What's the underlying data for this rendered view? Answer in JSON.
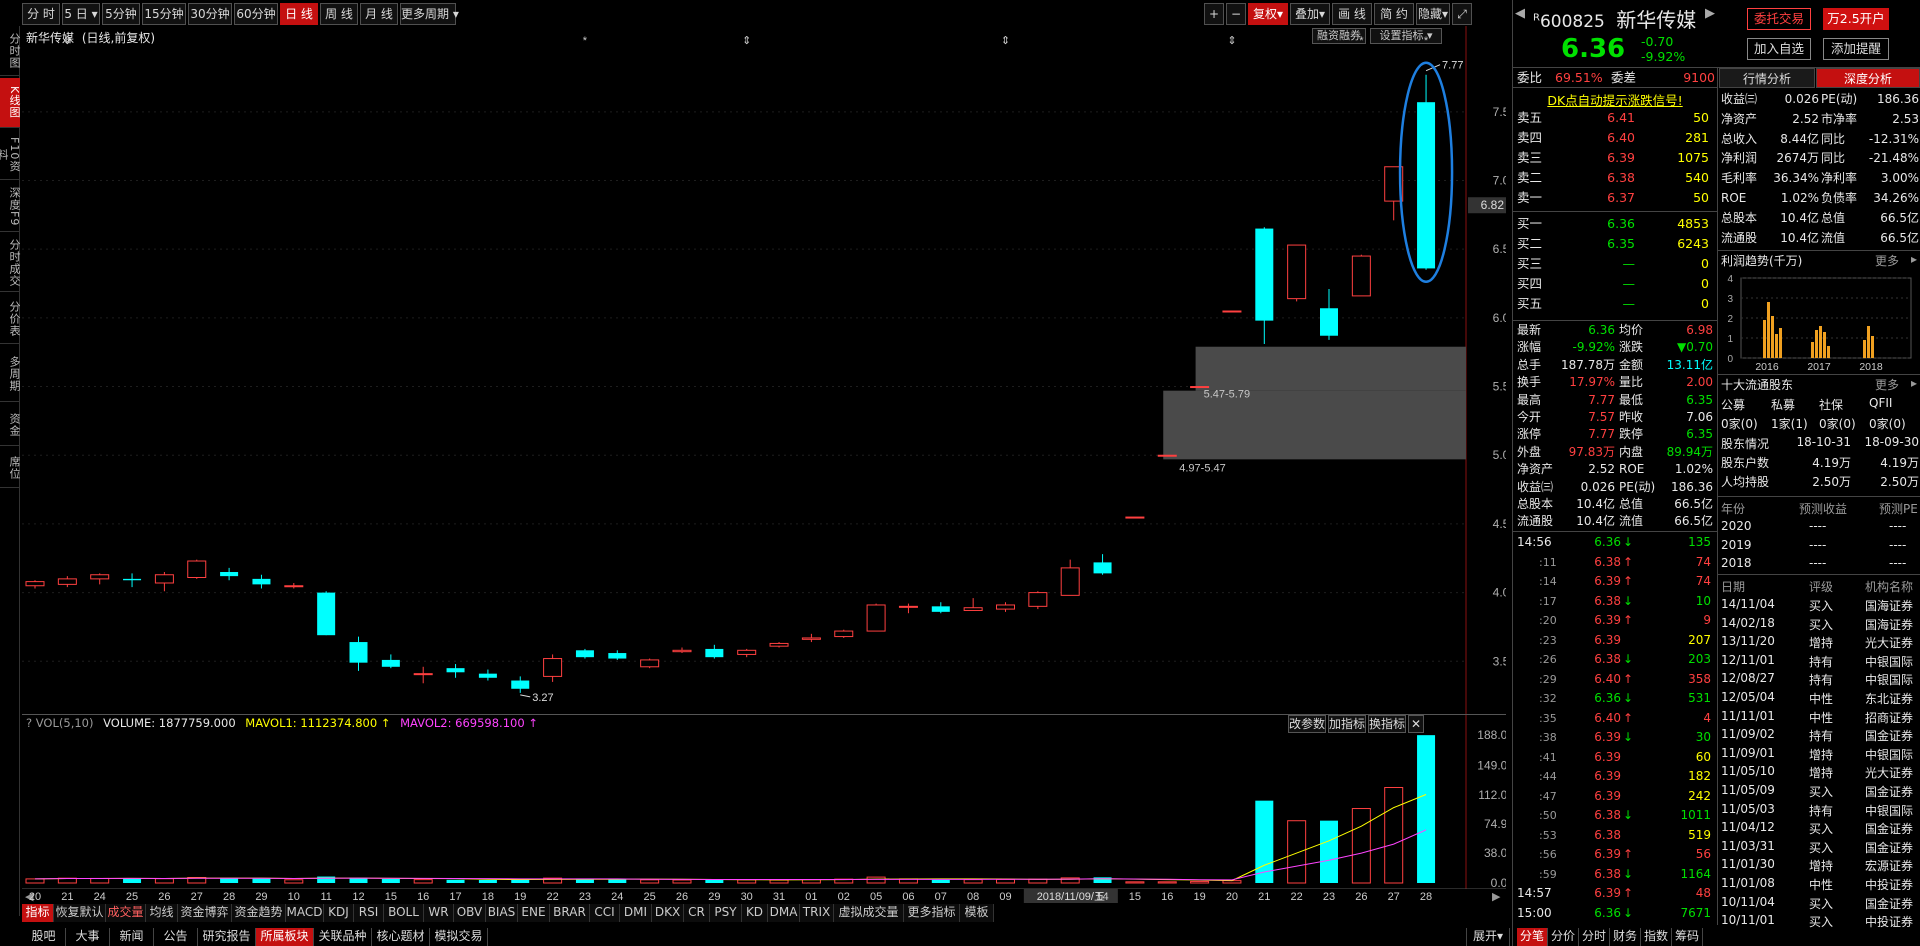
{
  "toolbar": {
    "periods": [
      "分 时",
      "5 日",
      "5分钟",
      "15分钟",
      "30分钟",
      "60分钟",
      "日 线",
      "周 线",
      "月 线",
      "更多周期"
    ],
    "active_period": "日 线",
    "right_buttons": [
      "+",
      "−",
      "复权",
      "叠加",
      "画 线",
      "简 约",
      "隐藏",
      "⤢"
    ]
  },
  "left_tabs": [
    "分时图",
    "K线图",
    "F10资料",
    "深度F9",
    "分时成交",
    "分价表",
    "多周期",
    "资金",
    "席位"
  ],
  "chart": {
    "title": "新华传媒",
    "subtitle": "(日线,前复权)",
    "btn_margin": "融资融券",
    "btn_settings": "设置指标",
    "price_labels": [
      "7.50",
      "7.00",
      "6.50",
      "6.00",
      "5.50",
      "5.00",
      "4.50",
      "4.00",
      "3.50"
    ],
    "current_price_tag": "6.82",
    "high_annot": "7.77",
    "low_annot": "3.27",
    "zone1_label": "5.47-5.79",
    "zone2_label": "4.97-5.47"
  },
  "chart_data": {
    "type": "candlestick",
    "dates": [
      "20",
      "21",
      "24",
      "25",
      "26",
      "27",
      "28",
      "29",
      "10",
      "11",
      "12",
      "15",
      "16",
      "17",
      "18",
      "19",
      "22",
      "23",
      "24",
      "25",
      "26",
      "29",
      "30",
      "31",
      "01",
      "02",
      "05",
      "06",
      "07",
      "08",
      "09",
      "12",
      "13",
      "14",
      "15",
      "16",
      "19",
      "20",
      "21",
      "22",
      "23",
      "26",
      "27",
      "28"
    ],
    "ohlc": [
      [
        4.05,
        4.09,
        4.03,
        4.08
      ],
      [
        4.06,
        4.12,
        4.04,
        4.1
      ],
      [
        4.1,
        4.14,
        4.06,
        4.13
      ],
      [
        4.1,
        4.14,
        4.04,
        4.09
      ],
      [
        4.07,
        4.15,
        4.01,
        4.13
      ],
      [
        4.11,
        4.24,
        4.1,
        4.23
      ],
      [
        4.15,
        4.18,
        4.09,
        4.12
      ],
      [
        4.1,
        4.13,
        4.03,
        4.06
      ],
      [
        4.05,
        4.07,
        4.03,
        4.05
      ],
      [
        4.0,
        4.01,
        3.69,
        3.69
      ],
      [
        3.64,
        3.68,
        3.43,
        3.49
      ],
      [
        3.51,
        3.55,
        3.45,
        3.46
      ],
      [
        3.41,
        3.46,
        3.34,
        3.41
      ],
      [
        3.45,
        3.48,
        3.38,
        3.42
      ],
      [
        3.41,
        3.44,
        3.36,
        3.38
      ],
      [
        3.36,
        3.39,
        3.27,
        3.3
      ],
      [
        3.39,
        3.55,
        3.35,
        3.52
      ],
      [
        3.58,
        3.59,
        3.52,
        3.53
      ],
      [
        3.56,
        3.58,
        3.51,
        3.52
      ],
      [
        3.46,
        3.52,
        3.45,
        3.51
      ],
      [
        3.57,
        3.6,
        3.56,
        3.58
      ],
      [
        3.59,
        3.62,
        3.52,
        3.53
      ],
      [
        3.55,
        3.59,
        3.53,
        3.58
      ],
      [
        3.61,
        3.64,
        3.6,
        3.63
      ],
      [
        3.66,
        3.7,
        3.64,
        3.67
      ],
      [
        3.68,
        3.73,
        3.67,
        3.72
      ],
      [
        3.72,
        3.92,
        3.72,
        3.91
      ],
      [
        3.9,
        3.92,
        3.85,
        3.9
      ],
      [
        3.9,
        3.93,
        3.85,
        3.86
      ],
      [
        3.87,
        3.96,
        3.87,
        3.89
      ],
      [
        3.88,
        3.93,
        3.86,
        3.91
      ],
      [
        3.9,
        4.01,
        3.88,
        4.0
      ],
      [
        3.98,
        4.24,
        3.98,
        4.18
      ],
      [
        4.22,
        4.28,
        4.13,
        4.14
      ],
      [
        4.55,
        4.55,
        4.55,
        4.55
      ],
      [
        5.0,
        5.0,
        5.0,
        5.0
      ],
      [
        5.5,
        5.5,
        5.5,
        5.5
      ],
      [
        6.05,
        6.05,
        6.05,
        6.05
      ],
      [
        6.65,
        6.66,
        5.81,
        5.98
      ],
      [
        6.14,
        6.53,
        6.12,
        6.53
      ],
      [
        6.07,
        6.21,
        5.84,
        5.87
      ],
      [
        6.16,
        6.46,
        6.16,
        6.45
      ],
      [
        6.85,
        7.1,
        6.71,
        7.1
      ],
      [
        7.57,
        7.77,
        6.35,
        6.36
      ]
    ],
    "volume": [
      5.2,
      6.1,
      5.8,
      6.3,
      5.5,
      7.0,
      6.2,
      5.6,
      4.1,
      8.2,
      6.5,
      5.1,
      4.3,
      4.0,
      3.9,
      4.6,
      6.2,
      5.0,
      4.5,
      4.0,
      3.8,
      4.6,
      4.0,
      3.7,
      4.4,
      4.9,
      7.5,
      5.2,
      4.1,
      4.3,
      4.5,
      4.8,
      6.5,
      7.2,
      1.5,
      1.5,
      2.0,
      3.0,
      104.6,
      79.1,
      79.2,
      94.6,
      121.3,
      187.8
    ],
    "volume_legend": {
      "name": "VOL(5,10)",
      "volume": "VOLUME: 1877759.000",
      "mavol1": "MAVOL1: 1112374.800",
      "mavol2": "MAVOL2: 669598.100"
    },
    "volume_labels": [
      "188.00",
      "149.00",
      "112.00",
      "74.90",
      "38.00",
      "0.00"
    ],
    "xaxis_date_popup": "2018/11/09/五"
  },
  "volume_panel": {
    "btns": [
      "改参数",
      "加指标",
      "换指标",
      "✕"
    ]
  },
  "bottom_tabs": [
    "指标",
    "恢复默认",
    "成交量",
    "均线",
    "资金博弈",
    "资金趋势",
    "MACD",
    "KDJ",
    "RSI",
    "BOLL",
    "WR",
    "OBV",
    "BIAS",
    "ENE",
    "BRAR",
    "CCI",
    "DMI",
    "DKX",
    "CR",
    "PSY",
    "KD",
    "DMA",
    "TRIX",
    "虚拟成交量",
    "更多指标",
    "模板"
  ],
  "status_tabs": [
    "股吧",
    "大事",
    "新闻",
    "公告",
    "研究报告",
    "所属板块",
    "关联品种",
    "核心题材",
    "模拟交易"
  ],
  "status_right": "展开",
  "stock": {
    "code": "600825",
    "prefix": "R",
    "name": "新华传媒",
    "price": "6.36",
    "change": "-0.70",
    "pct": "-9.92%",
    "btn_entrust": "委托交易",
    "btn_open": "万2.5开户",
    "btn_add": "加入自选",
    "btn_alert": "添加提醒",
    "tab_quote": "行情分析",
    "tab_depth": "深度分析"
  },
  "orderbook": {
    "weibi_label": "委比",
    "weibi": "69.51%",
    "weicha_label": "委差",
    "weicha": "9100",
    "banner": "DK点自动提示涨跌信号!",
    "sells": [
      [
        "卖五",
        "6.41",
        "50"
      ],
      [
        "卖四",
        "6.40",
        "281"
      ],
      [
        "卖三",
        "6.39",
        "1075"
      ],
      [
        "卖二",
        "6.38",
        "540"
      ],
      [
        "卖一",
        "6.37",
        "50"
      ]
    ],
    "buys": [
      [
        "买一",
        "6.36",
        "4853"
      ],
      [
        "买二",
        "6.35",
        "6243"
      ],
      [
        "买三",
        "—",
        "0"
      ],
      [
        "买四",
        "—",
        "0"
      ],
      [
        "买五",
        "—",
        "0"
      ]
    ]
  },
  "quote": [
    [
      "最新",
      "6.36",
      "均价",
      "6.98"
    ],
    [
      "涨幅",
      "-9.92%",
      "涨跌",
      "▼0.70"
    ],
    [
      "总手",
      "187.78万",
      "金额",
      "13.11亿"
    ],
    [
      "换手",
      "17.97%",
      "量比",
      "2.00"
    ],
    [
      "最高",
      "7.77",
      "最低",
      "6.35"
    ],
    [
      "今开",
      "7.57",
      "昨收",
      "7.06"
    ],
    [
      "涨停",
      "7.77",
      "跌停",
      "6.35"
    ],
    [
      "外盘",
      "97.83万",
      "内盘",
      "89.94万"
    ],
    [
      "净资产",
      "2.52",
      "ROE",
      "1.02%"
    ],
    [
      "收益㈢",
      "0.026",
      "PE(动)",
      "186.36"
    ],
    [
      "总股本",
      "10.4亿",
      "总值",
      "66.5亿"
    ],
    [
      "流通股",
      "10.4亿",
      "流值",
      "66.5亿"
    ]
  ],
  "ticks": [
    [
      "14:56",
      "6.36",
      "↓",
      "135"
    ],
    [
      ":11",
      "6.38",
      "↑",
      "74"
    ],
    [
      ":14",
      "6.39",
      "↑",
      "74"
    ],
    [
      ":17",
      "6.38",
      "↓",
      "10"
    ],
    [
      ":20",
      "6.39",
      "↑",
      "9"
    ],
    [
      ":23",
      "6.39",
      "",
      "207"
    ],
    [
      ":26",
      "6.38",
      "↓",
      "203"
    ],
    [
      ":29",
      "6.40",
      "↑",
      "358"
    ],
    [
      ":32",
      "6.36",
      "↓",
      "531"
    ],
    [
      ":35",
      "6.40",
      "↑",
      "4"
    ],
    [
      ":38",
      "6.39",
      "↓",
      "30"
    ],
    [
      ":41",
      "6.39",
      "",
      "60"
    ],
    [
      ":44",
      "6.39",
      "",
      "182"
    ],
    [
      ":47",
      "6.39",
      "",
      "242"
    ],
    [
      ":50",
      "6.38",
      "↓",
      "1011"
    ],
    [
      ":53",
      "6.38",
      "",
      "519"
    ],
    [
      ":56",
      "6.39",
      "↑",
      "56"
    ],
    [
      ":59",
      "6.38",
      "↓",
      "1164"
    ],
    [
      "14:57",
      "6.39",
      "↑",
      "48"
    ],
    [
      "15:00",
      "6.36",
      "↓",
      "7671"
    ]
  ],
  "fundamentals": [
    [
      "收益㈢",
      "0.026",
      "PE(动)",
      "186.36"
    ],
    [
      "净资产",
      "2.52",
      "市净率",
      "2.53"
    ],
    [
      "总收入",
      "8.44亿",
      "同比",
      "-12.31%"
    ],
    [
      "净利润",
      "2674万",
      "同比",
      "-21.48%"
    ],
    [
      "毛利率",
      "36.34%",
      "净利率",
      "3.00%"
    ],
    [
      "ROE",
      "1.02%",
      "负债率",
      "34.26%"
    ],
    [
      "总股本",
      "10.4亿",
      "总值",
      "66.5亿"
    ],
    [
      "流通股",
      "10.4亿",
      "流值",
      "66.5亿"
    ]
  ],
  "profit_trend": {
    "title": "利润趋势(千万)",
    "more": "更多",
    "years": [
      "2016",
      "2017",
      "2018"
    ],
    "yticks": [
      "4",
      "3",
      "2",
      "1",
      "0"
    ]
  },
  "holders": {
    "title": "十大流通股东",
    "more": "更多",
    "headers": [
      "公募",
      "私募",
      "社保",
      "QFII"
    ],
    "values": [
      "0家(0)",
      "1家(1)",
      "0家(0)",
      "0家(0)"
    ],
    "rows": [
      [
        "股东情况",
        "18-10-31",
        "18-09-30"
      ],
      [
        "股东户数",
        "4.19万",
        "4.19万"
      ],
      [
        "人均持股",
        "2.50万",
        "2.50万"
      ]
    ]
  },
  "forecast": {
    "headers": [
      "年份",
      "预测收益",
      "预测PE"
    ],
    "rows": [
      [
        "2020",
        "----",
        "----"
      ],
      [
        "2019",
        "----",
        "----"
      ],
      [
        "2018",
        "----",
        "----"
      ]
    ]
  },
  "ratings": {
    "headers": [
      "日期",
      "评级",
      "机构名称"
    ],
    "rows": [
      [
        "14/11/04",
        "买入",
        "国海证券"
      ],
      [
        "14/02/18",
        "买入",
        "国海证券"
      ],
      [
        "13/11/20",
        "增持",
        "光大证券"
      ],
      [
        "12/11/01",
        "持有",
        "中银国际"
      ],
      [
        "12/08/27",
        "持有",
        "中银国际"
      ],
      [
        "12/05/04",
        "中性",
        "东北证券"
      ],
      [
        "11/11/01",
        "中性",
        "招商证券"
      ],
      [
        "11/09/02",
        "持有",
        "国金证券"
      ],
      [
        "11/09/01",
        "增持",
        "中银国际"
      ],
      [
        "11/05/10",
        "增持",
        "光大证券"
      ],
      [
        "11/05/09",
        "买入",
        "国金证券"
      ],
      [
        "11/05/03",
        "持有",
        "中银国际"
      ],
      [
        "11/04/12",
        "买入",
        "国金证券"
      ],
      [
        "11/03/31",
        "买入",
        "国金证券"
      ],
      [
        "11/01/30",
        "增持",
        "宏源证券"
      ],
      [
        "11/01/08",
        "中性",
        "中投证券"
      ],
      [
        "10/11/04",
        "买入",
        "国金证券"
      ],
      [
        "10/11/01",
        "买入",
        "中投证券"
      ]
    ]
  },
  "right_bottom_tabs": [
    "分笔",
    "分价",
    "分时",
    "财务",
    "指数",
    "筹码"
  ]
}
